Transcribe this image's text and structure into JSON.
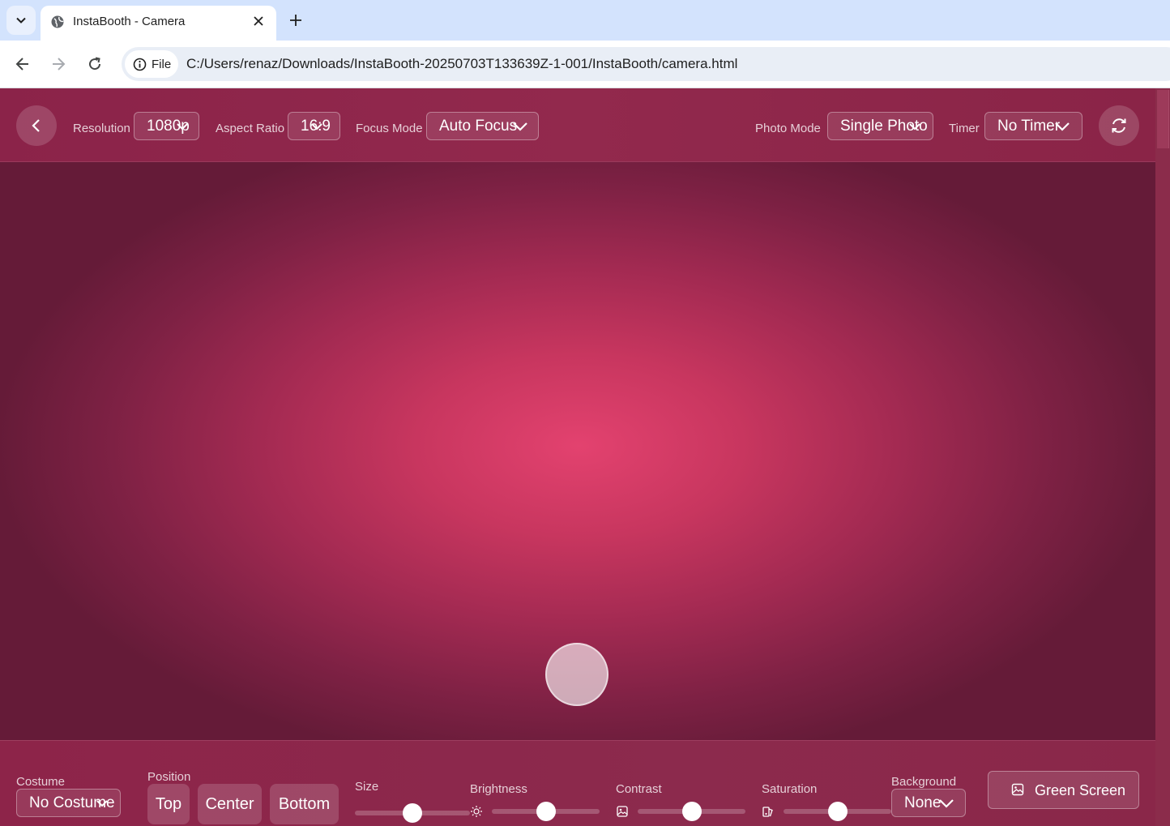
{
  "browser": {
    "tab_title": "InstaBooth - Camera",
    "site_chip": "File",
    "url": "C:/Users/renaz/Downloads/InstaBooth-20250703T133639Z-1-001/InstaBooth/camera.html"
  },
  "topbar": {
    "resolution": {
      "label": "Resolution",
      "value": "1080p"
    },
    "aspect_ratio": {
      "label": "Aspect Ratio",
      "value": "16:9"
    },
    "focus_mode": {
      "label": "Focus Mode",
      "value": "Auto Focus"
    },
    "photo_mode": {
      "label": "Photo Mode",
      "value": "Single Photo"
    },
    "timer": {
      "label": "Timer",
      "value": "No Timer"
    }
  },
  "bottombar": {
    "costume": {
      "label": "Costume",
      "value": "No Costume"
    },
    "position": {
      "label": "Position",
      "options": [
        "Top",
        "Center",
        "Bottom"
      ]
    },
    "size": {
      "label": "Size",
      "level": 0.5
    },
    "brightness": {
      "label": "Brightness",
      "level": 0.5
    },
    "contrast": {
      "label": "Contrast",
      "level": 0.5
    },
    "saturation": {
      "label": "Saturation",
      "level": 0.5
    },
    "background": {
      "label": "Background",
      "value": "None"
    },
    "green_screen_label": "Green Screen"
  },
  "icons": {
    "back": "chevron-left-icon",
    "switch_camera": "refresh-icon",
    "brightness": "sun-icon",
    "contrast": "image-icon",
    "saturation": "palette-icon",
    "green_screen": "image-icon"
  },
  "colors": {
    "brand": "#8b2349",
    "viewport_center": "#e3426f"
  }
}
